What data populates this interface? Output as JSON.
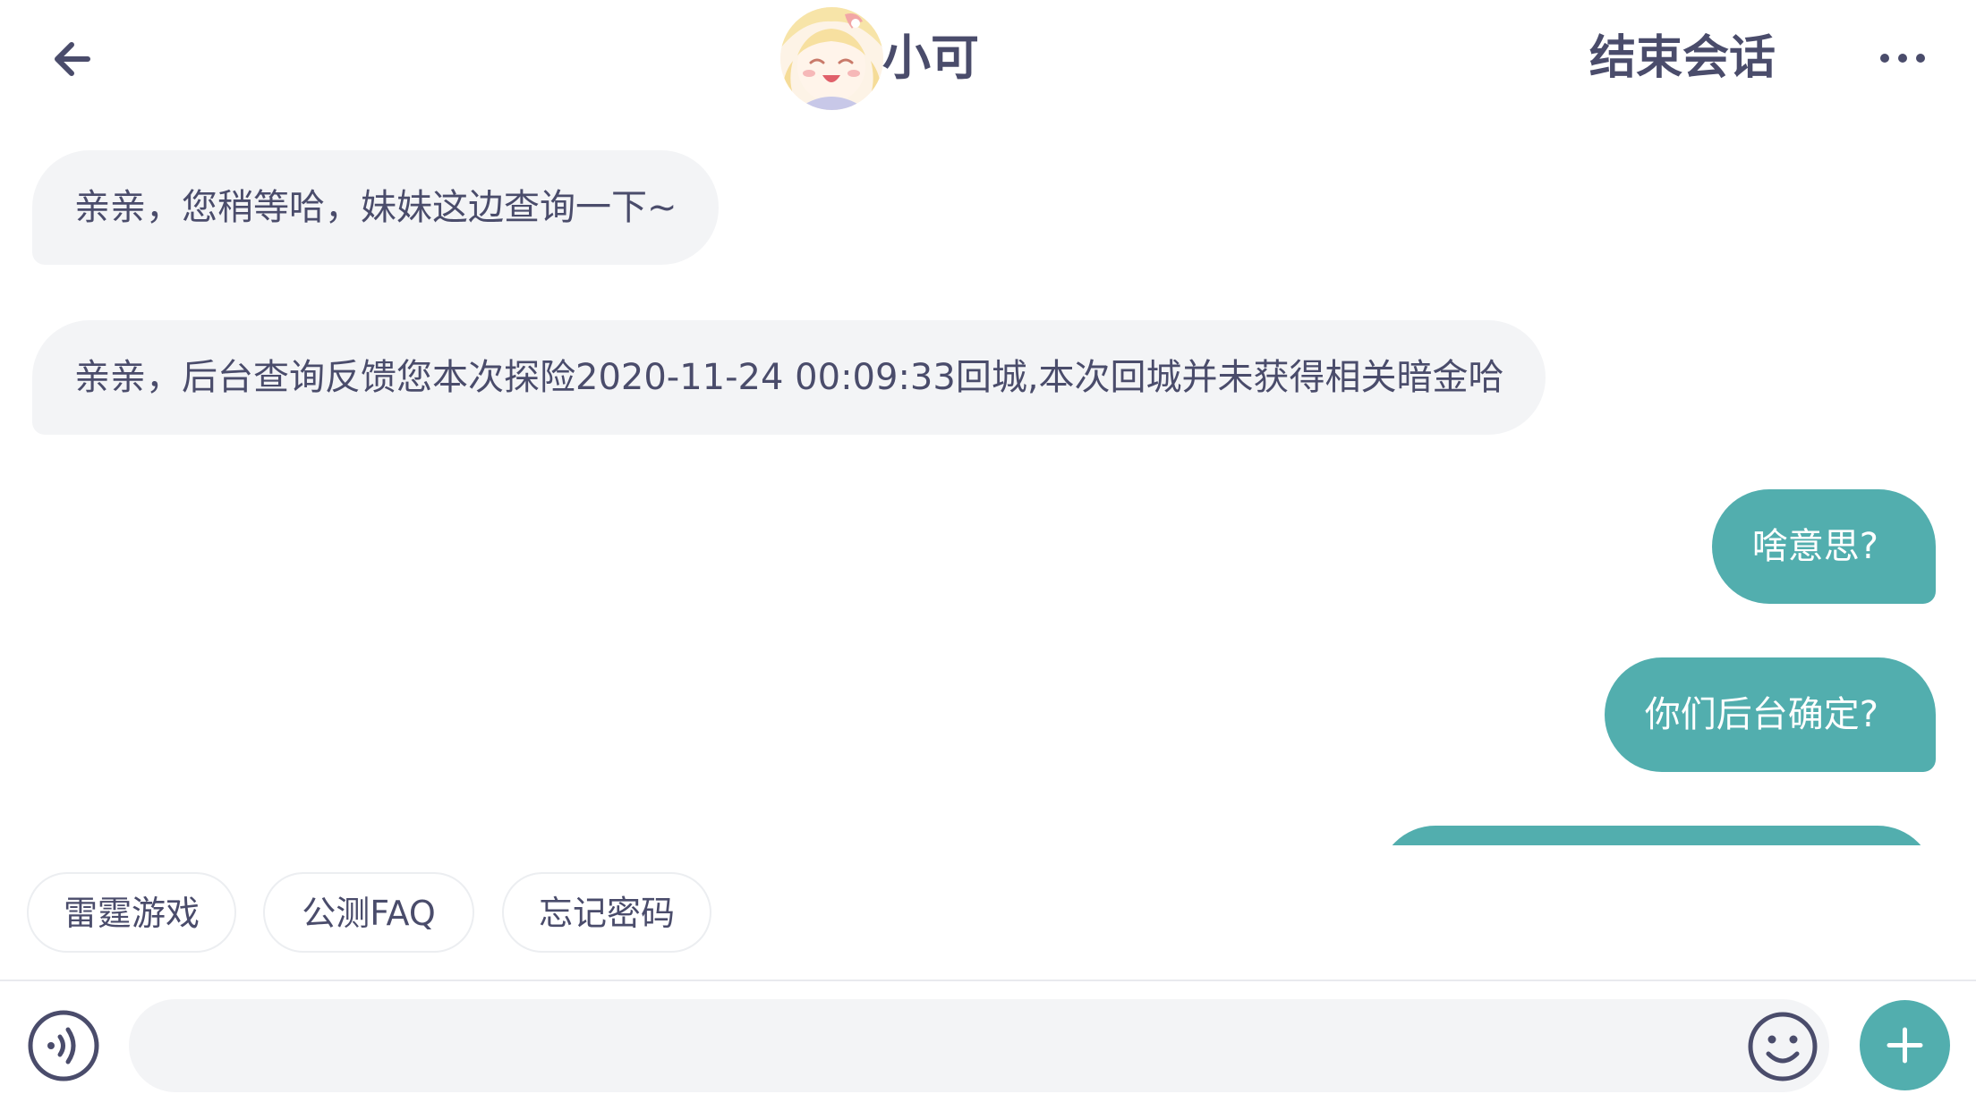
{
  "header": {
    "back_icon": "arrow-left-icon",
    "avatar_icon": "anime-girl-avatar",
    "agent_name": "小可",
    "end_session_label": "结束会话",
    "more_icon": "ellipsis-icon"
  },
  "messages": [
    {
      "sender": "agent",
      "text": "亲亲，您稍等哈，妹妹这边查询一下~"
    },
    {
      "sender": "agent",
      "text": "亲亲，后台查询反馈您本次探险2020-11-24 00:09:33回城,本次回城并未获得相关暗金哈"
    },
    {
      "sender": "user",
      "text": "啥意思?"
    },
    {
      "sender": "user",
      "text": "你们后台确定?"
    },
    {
      "sender": "user",
      "text": ""
    }
  ],
  "quick_replies": [
    {
      "label": "雷霆游戏"
    },
    {
      "label": "公测FAQ"
    },
    {
      "label": "忘记密码"
    }
  ],
  "input": {
    "value": "",
    "placeholder": "",
    "voice_icon": "voice-icon",
    "emoji_icon": "smiley-icon",
    "add_icon": "plus-icon"
  },
  "colors": {
    "accent": "#52aeae",
    "text": "#4a4c6b",
    "incoming_bubble": "#f3f4f6",
    "input_background": "#f3f4f6",
    "divider": "#e9eaee"
  }
}
